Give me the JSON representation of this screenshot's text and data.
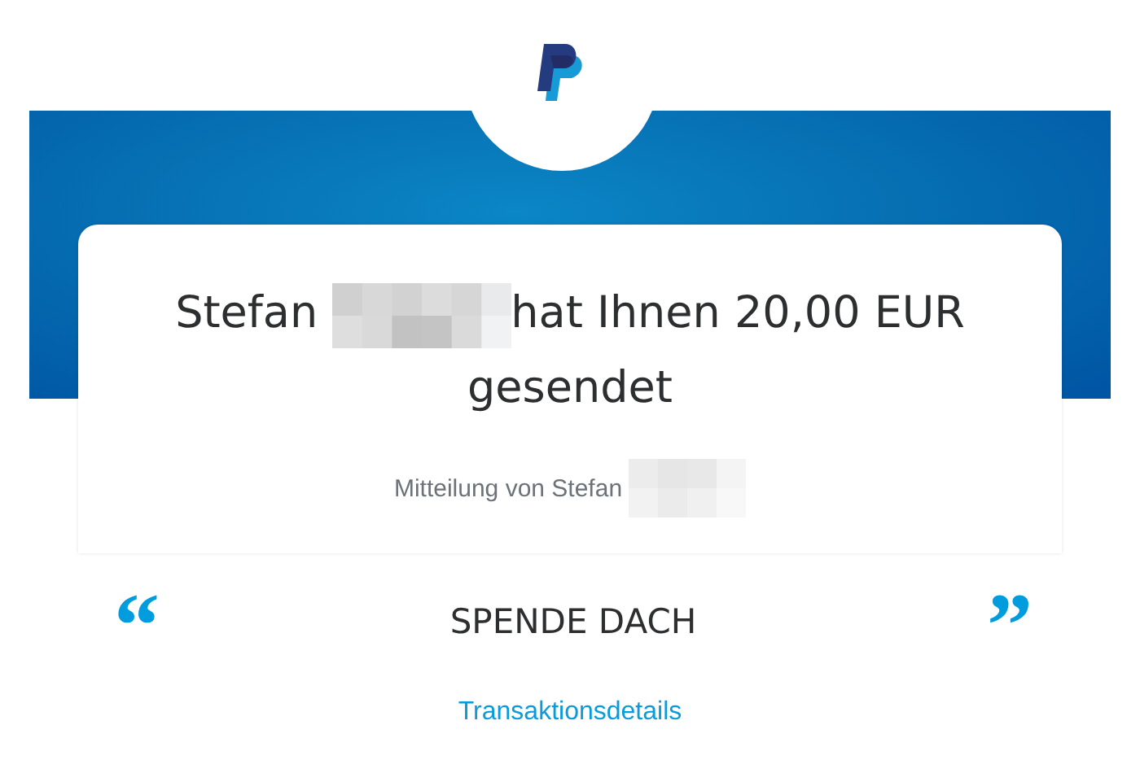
{
  "headline": {
    "sender": "Stefan",
    "text": "hat Ihnen 20,00 EUR gesendet"
  },
  "message_label": "Mitteilung von Stefan",
  "note": {
    "open_quote": "“",
    "text": "SPENDE DACH",
    "close_quote": "”"
  },
  "details_link": "Transaktionsdetails"
}
